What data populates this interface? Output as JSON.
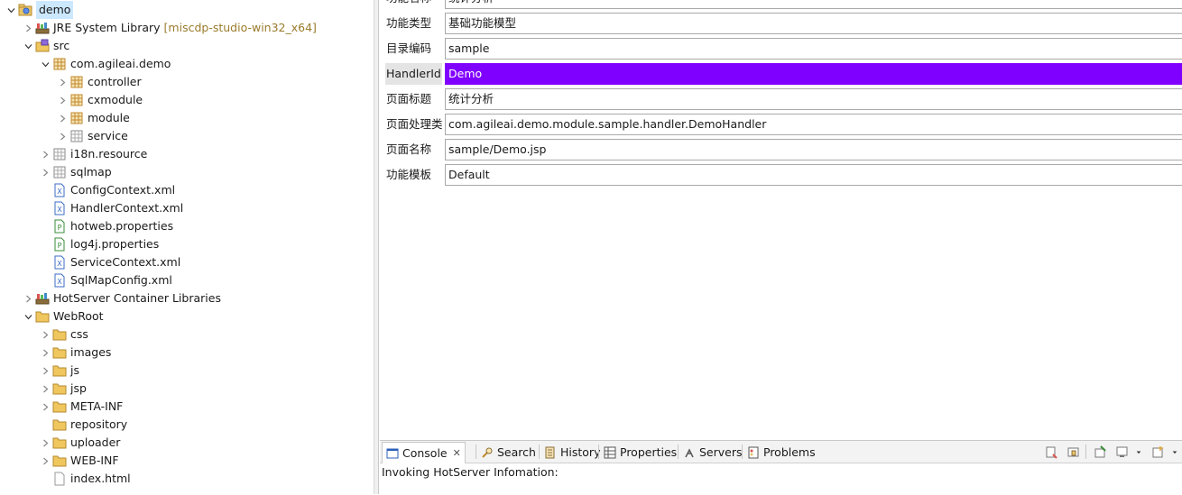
{
  "tree": {
    "items": [
      {
        "label": "demo",
        "icon": "java-project-icon",
        "expander": "open",
        "depth": 0,
        "selected": true
      },
      {
        "label": "JRE System Library",
        "decoration": "[miscdp-studio-win32_x64]",
        "icon": "library-icon",
        "expander": "closed",
        "depth": 1
      },
      {
        "label": "src",
        "icon": "source-folder-icon",
        "expander": "open",
        "depth": 1
      },
      {
        "label": "com.agileai.demo",
        "icon": "package-icon",
        "expander": "open",
        "depth": 2
      },
      {
        "label": "controller",
        "icon": "package-icon",
        "expander": "closed",
        "depth": 3
      },
      {
        "label": "cxmodule",
        "icon": "package-icon",
        "expander": "closed",
        "depth": 3
      },
      {
        "label": "module",
        "icon": "package-icon",
        "expander": "closed",
        "depth": 3
      },
      {
        "label": "service",
        "icon": "package-empty-icon",
        "expander": "closed",
        "depth": 3
      },
      {
        "label": "i18n.resource",
        "icon": "package-empty-icon",
        "expander": "closed",
        "depth": 2
      },
      {
        "label": "sqlmap",
        "icon": "package-empty-icon",
        "expander": "closed",
        "depth": 2
      },
      {
        "label": "ConfigContext.xml",
        "icon": "xml-file-icon",
        "expander": "none",
        "depth": 2
      },
      {
        "label": "HandlerContext.xml",
        "icon": "xml-file-icon",
        "expander": "none",
        "depth": 2
      },
      {
        "label": "hotweb.properties",
        "icon": "properties-file-icon",
        "expander": "none",
        "depth": 2
      },
      {
        "label": "log4j.properties",
        "icon": "properties-file-icon",
        "expander": "none",
        "depth": 2
      },
      {
        "label": "ServiceContext.xml",
        "icon": "xml-file-icon",
        "expander": "none",
        "depth": 2
      },
      {
        "label": "SqlMapConfig.xml",
        "icon": "xml-file-icon",
        "expander": "none",
        "depth": 2
      },
      {
        "label": "HotServer Container Libraries",
        "icon": "library-icon",
        "expander": "closed",
        "depth": 1
      },
      {
        "label": "WebRoot",
        "icon": "folder-icon",
        "expander": "open",
        "depth": 1
      },
      {
        "label": "css",
        "icon": "folder-icon",
        "expander": "closed",
        "depth": 2
      },
      {
        "label": "images",
        "icon": "folder-icon",
        "expander": "closed",
        "depth": 2
      },
      {
        "label": "js",
        "icon": "folder-icon",
        "expander": "closed",
        "depth": 2
      },
      {
        "label": "jsp",
        "icon": "folder-icon",
        "expander": "closed",
        "depth": 2
      },
      {
        "label": "META-INF",
        "icon": "folder-icon",
        "expander": "closed",
        "depth": 2
      },
      {
        "label": "repository",
        "icon": "folder-icon",
        "expander": "none",
        "depth": 2
      },
      {
        "label": "uploader",
        "icon": "folder-icon",
        "expander": "closed",
        "depth": 2
      },
      {
        "label": "WEB-INF",
        "icon": "folder-icon",
        "expander": "closed",
        "depth": 2
      },
      {
        "label": "index.html",
        "icon": "html-file-icon",
        "expander": "none",
        "depth": 2
      }
    ]
  },
  "form": {
    "fields": [
      {
        "label": "功能名称",
        "value": "统计分析"
      },
      {
        "label": "功能类型",
        "value": "基础功能模型"
      },
      {
        "label": "目录编码",
        "value": "sample"
      },
      {
        "label": "HandlerId",
        "value": "Demo",
        "highlighted": true
      },
      {
        "label": "页面标题",
        "value": "统计分析"
      },
      {
        "label": "页面处理类",
        "value": "com.agileai.demo.module.sample.handler.DemoHandler"
      },
      {
        "label": "页面名称",
        "value": "sample/Demo.jsp"
      },
      {
        "label": "功能模板",
        "value": "Default"
      }
    ]
  },
  "bottom_panel": {
    "tabs": [
      {
        "label": "Console",
        "icon": "console-icon",
        "active": true,
        "closable": true
      },
      {
        "label": "Search",
        "icon": "search-icon"
      },
      {
        "label": "History",
        "icon": "history-icon"
      },
      {
        "label": "Properties",
        "icon": "properties-icon"
      },
      {
        "label": "Servers",
        "icon": "servers-icon"
      },
      {
        "label": "Problems",
        "icon": "problems-icon"
      }
    ],
    "close_glyph": "✕",
    "toolbar": [
      "clear-console-icon",
      "scroll-lock-icon",
      "pin-console-icon",
      "display-selected-console-icon",
      "dropdown-arrow-icon",
      "open-console-icon",
      "dropdown-arrow-icon"
    ],
    "console_text": "Invoking HotServer Infomation:"
  },
  "colors": {
    "selection": "#cce8ff",
    "highlight": "#8000ff",
    "decoration": "#9a7b2c"
  }
}
